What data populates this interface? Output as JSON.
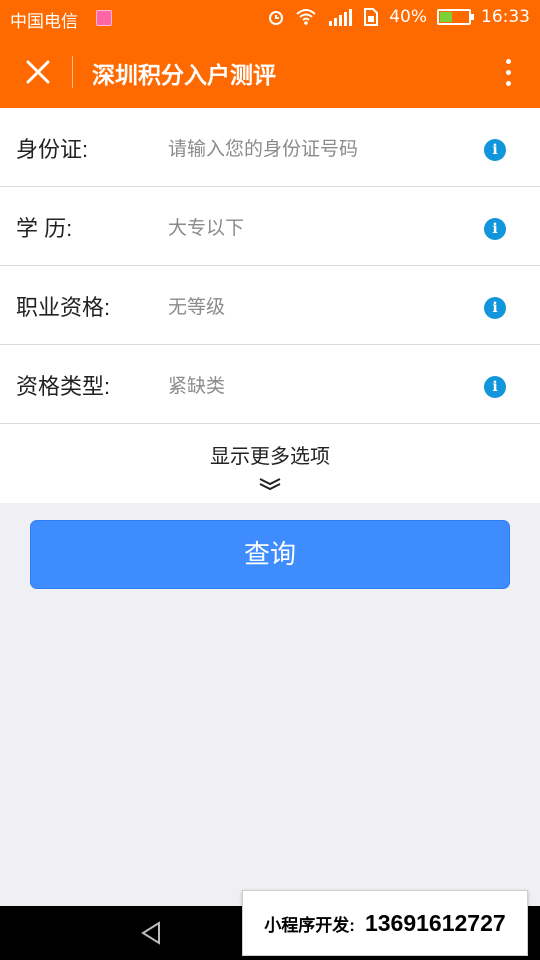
{
  "status_bar": {
    "carrier": "中国电信",
    "battery": "40%",
    "time": "16:33",
    "network_badge": "4G 2G",
    "icons": [
      "alarm-icon",
      "wifi-icon",
      "signal-icon",
      "sim-icon",
      "battery-icon"
    ]
  },
  "header": {
    "title": "深圳积分入户测评",
    "close_icon": "close-icon",
    "more_icon": "more-vertical-icon"
  },
  "form": {
    "rows": [
      {
        "label": "身份证:",
        "value": "请输入您的身份证号码"
      },
      {
        "label": "学 历:",
        "value": "大专以下"
      },
      {
        "label": "职业资格:",
        "value": "无等级"
      },
      {
        "label": "资格类型:",
        "value": "紧缺类"
      }
    ],
    "more_options": "显示更多选项"
  },
  "actions": {
    "query_label": "查询"
  },
  "promo": {
    "prefix": "小程序开发:",
    "phone": "13691612727"
  },
  "colors": {
    "header": "#ff6a00",
    "primary_button": "#3f8cff",
    "info_icon": "#1296db",
    "background": "#efeff4"
  }
}
